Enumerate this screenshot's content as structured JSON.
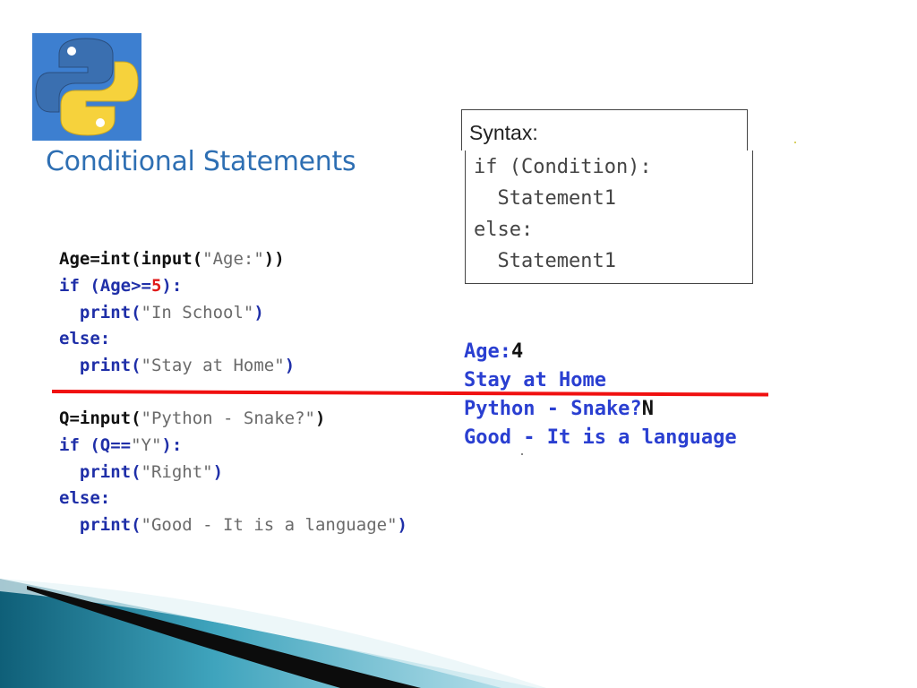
{
  "slide": {
    "title": "Conditional Statements"
  },
  "syntax_box": {
    "header": "Syntax:",
    "lines": [
      "if (Condition):",
      "  Statement1",
      "else:",
      "  Statement1"
    ]
  },
  "code_example_1": {
    "line1": {
      "var": "Age=",
      "fn1": "int(input(",
      "str": "\"Age:\"",
      "close": "))"
    },
    "line2": {
      "kw": "if (Age>=",
      "num": "5",
      "close": "):"
    },
    "line3": {
      "fn": "print(",
      "str": "\"In School\"",
      "close": ")"
    },
    "line4": {
      "kw": "else:"
    },
    "line5": {
      "fn": "print(",
      "str": "\"Stay at Home\"",
      "close": ")"
    }
  },
  "code_example_2": {
    "line1": {
      "var": "Q=",
      "fn": "input(",
      "str": "\"Python - Snake?\"",
      "close": ")"
    },
    "line2": {
      "kw": "if (Q==",
      "str": "\"Y\"",
      "close": "):"
    },
    "line3": {
      "fn": "print(",
      "str": "\"Right\"",
      "close": ")"
    },
    "line4": {
      "kw": "else:"
    },
    "line5": {
      "fn": "print(",
      "str": "\"Good - It is a language\"",
      "close": ")"
    }
  },
  "output": {
    "line1_prompt": "Age:",
    "line1_input": "4",
    "line2": "Stay at Home",
    "line3_prompt": "Python - Snake?",
    "line3_input": "N",
    "line4": "Good - It is a language"
  },
  "colors": {
    "title": "#2e6fb3",
    "keyword": "#1f2fa8",
    "string": "#6a6a6a",
    "number": "#e01a1a",
    "output": "#2a3fd1",
    "divider": "#f01010",
    "logo_bg": "#3d7fd0"
  },
  "icons": {
    "logo": "python-logo-icon"
  }
}
